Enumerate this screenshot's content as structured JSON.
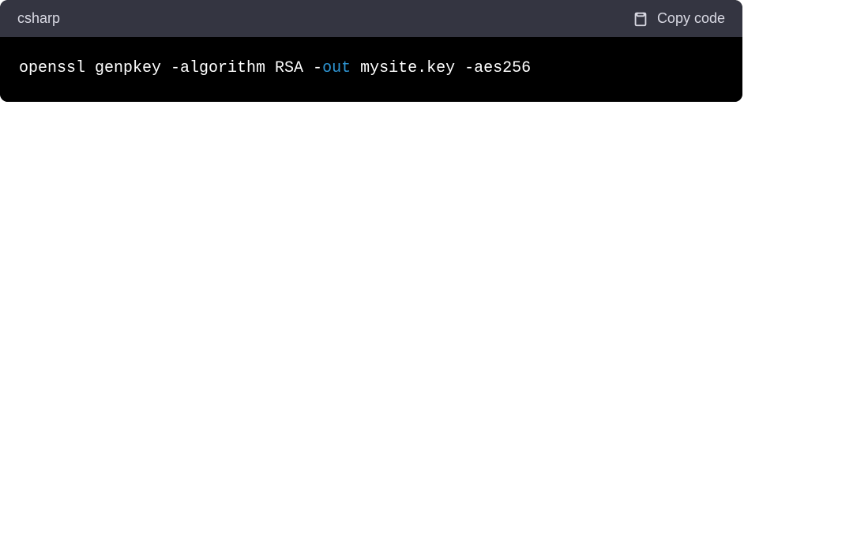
{
  "codeBlock": {
    "language": "csharp",
    "copyLabel": "Copy code",
    "tokens": [
      {
        "text": "openssl genpkey -algorithm RSA -",
        "cls": ""
      },
      {
        "text": "out",
        "cls": "kw"
      },
      {
        "text": " mysite.key -aes256",
        "cls": ""
      }
    ]
  }
}
